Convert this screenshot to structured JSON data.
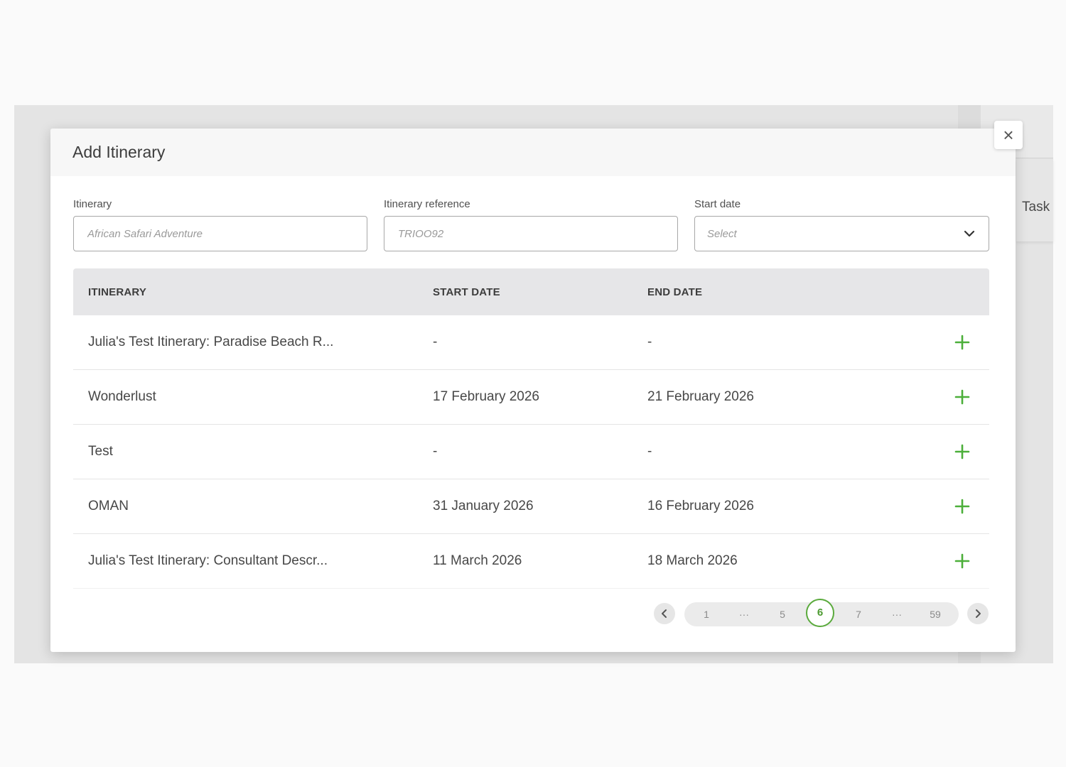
{
  "background": {
    "tasks_label": "Task"
  },
  "modal": {
    "title": "Add Itinerary",
    "close_label": "×"
  },
  "filters": {
    "itinerary": {
      "label": "Itinerary",
      "placeholder": "African Safari Adventure"
    },
    "reference": {
      "label": "Itinerary reference",
      "placeholder": "TRIOO92"
    },
    "start_date": {
      "label": "Start date",
      "value": "Select"
    }
  },
  "table": {
    "headers": [
      "ITINERARY",
      "START DATE",
      "END DATE"
    ],
    "rows": [
      {
        "name": "Julia's Test Itinerary: Paradise Beach R...",
        "start": "-",
        "end": "-"
      },
      {
        "name": "Wonderlust",
        "start": "17 February 2026",
        "end": "21 February 2026"
      },
      {
        "name": "Test",
        "start": "-",
        "end": "-"
      },
      {
        "name": "OMAN",
        "start": "31 January 2026",
        "end": "16 February 2026"
      },
      {
        "name": "Julia's Test Itinerary: Consultant Descr...",
        "start": "11 March 2026",
        "end": "18 March 2026"
      }
    ]
  },
  "pagination": {
    "pages": [
      "1",
      "···",
      "5",
      "6",
      "7",
      "···",
      "59"
    ],
    "current": "6"
  },
  "colors": {
    "accent_green": "#4caf3a",
    "header_bg": "#e6e6e8",
    "backdrop": "#e4e4e4"
  }
}
